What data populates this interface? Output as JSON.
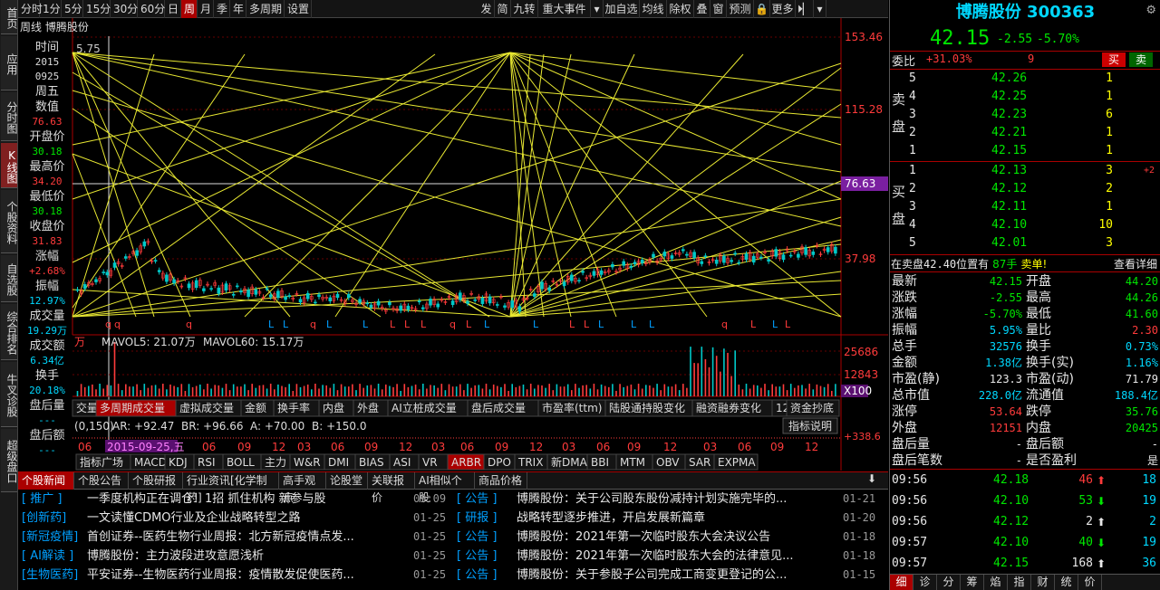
{
  "left_nav": [
    {
      "label": "首页",
      "active": false
    },
    {
      "label": "应用",
      "active": false
    },
    {
      "label": "分时图",
      "active": false
    },
    {
      "label": "K线图",
      "active": true
    },
    {
      "label": "个股资料",
      "active": false
    },
    {
      "label": "自选股",
      "active": false
    },
    {
      "label": "综合排名",
      "active": false
    },
    {
      "label": "牛叉诊股",
      "active": false
    },
    {
      "label": "超级盘口",
      "active": false
    }
  ],
  "toolbar": {
    "periods": [
      "分时",
      "1分",
      "5分",
      "15分",
      "30分",
      "60分",
      "日",
      "周",
      "月",
      "季",
      "年",
      "多周期",
      "设置"
    ],
    "active_period": "周",
    "right_items": [
      "发",
      "简",
      "九转",
      "重大事件",
      "▾",
      "加自选",
      "均线",
      "除权",
      "叠",
      "窗",
      "预测",
      "🔒",
      "更多",
      "⏵▏",
      "▾"
    ]
  },
  "chart": {
    "caption": "周线  博腾股份",
    "info_column": [
      {
        "label": "时间",
        "value": "2015",
        "color": "#ddd"
      },
      {
        "label": "",
        "value": "0925",
        "color": "#ddd"
      },
      {
        "label": "周五",
        "value": "",
        "color": "#ddd"
      },
      {
        "label": "数值",
        "value": "76.63",
        "color": "#ff3b3b"
      },
      {
        "label": "开盘价",
        "value": "30.18",
        "color": "#00e600"
      },
      {
        "label": "最高价",
        "value": "34.20",
        "color": "#ff3b3b"
      },
      {
        "label": "最低价",
        "value": "30.18",
        "color": "#00e600"
      },
      {
        "label": "收盘价",
        "value": "31.83",
        "color": "#ff3b3b"
      },
      {
        "label": "涨幅",
        "value": "+2.68%",
        "color": "#ff3b3b"
      },
      {
        "label": "振幅",
        "value": "12.97%",
        "color": "#00d8ff"
      },
      {
        "label": "成交量",
        "value": "19.29万",
        "color": "#00d8ff"
      },
      {
        "label": "成交额",
        "value": "6.34亿",
        "color": "#00d8ff"
      },
      {
        "label": "换手",
        "value": "20.18%",
        "color": "#00d8ff"
      },
      {
        "label": "盘后量",
        "value": "---",
        "color": "#00d8ff"
      },
      {
        "label": "盘后额",
        "value": "---",
        "color": "#00d8ff"
      }
    ],
    "price_axis": [
      "153.46",
      "115.28",
      "76.63",
      "37.98"
    ],
    "top_left_label": "5.75",
    "vol_axis": [
      "25686",
      "12843",
      "X100"
    ],
    "vol_legend": {
      "prefix": "万",
      "mavol5": "MAVOL5: 21.07万",
      "mavol60": "MAVOL60: 15.17万"
    },
    "vol_tabs": [
      "交量",
      "多周期成交量",
      "虚拟成交量",
      "金额",
      "换手率",
      "内盘",
      "外盘",
      "AI立桩成交量",
      "盘后成交量",
      "市盈率(ttm)",
      "陆股通持股变化",
      "融资融券变化",
      "12",
      "资金抄底"
    ],
    "active_vol_tab": "多周期成交量",
    "arbr_legend": {
      "params": "(0,150)",
      "ar": "AR: +92.47",
      "br": "BR: +96.66",
      "a": "A: +70.00",
      "b": "B: +150.0"
    },
    "indicator_button": "指标说明",
    "arbr_right": "+338.6",
    "date_axis": [
      "06",
      "2015-09-25,五",
      "06",
      "09",
      "12",
      "03",
      "06",
      "09",
      "12",
      "03",
      "06",
      "09",
      "12",
      "03",
      "06",
      "09",
      "12",
      "03",
      "06",
      "09",
      "12"
    ],
    "indicator_tabs": [
      "指标广场",
      "MACD",
      "KDJ",
      "RSI",
      "BOLL",
      "主力",
      "W&R",
      "DMI",
      "BIAS",
      "ASI",
      "VR",
      "ARBR",
      "DPO",
      "TRIX",
      "新DMA",
      "BBI",
      "MTM",
      "OBV",
      "SAR",
      "EXPMA"
    ],
    "active_indicator": "ARBR"
  },
  "news": {
    "tabs": [
      "个股新闻",
      "个股公告",
      "个股研报",
      "行业资讯[化学制药]",
      "高手观点",
      "论股堂",
      "关联报价",
      "AI相似个股",
      "商品价格"
    ],
    "active_tab": "个股新闻",
    "left": [
      {
        "tag": "[ 推广 ]",
        "title": "一季度机构正在调仓！1招 抓住机构 新参与股",
        "date": "09:09"
      },
      {
        "tag": "[创新药]",
        "title": "一文读懂CDMO行业及企业战略转型之路",
        "date": "01-25"
      },
      {
        "tag": "[新冠疫情]",
        "title": "首创证券--医药生物行业周报：北方新冠疫情点发...",
        "date": "01-25"
      },
      {
        "tag": "[ AI解读 ]",
        "title": "博腾股份：主力波段进攻意愿浅析",
        "date": "01-25"
      },
      {
        "tag": "[生物医药]",
        "title": "平安证券--生物医药行业周报：疫情散发促使医药...",
        "date": "01-25"
      }
    ],
    "right": [
      {
        "tag": "[ 公告 ]",
        "title": "博腾股份：关于公司股东股份减持计划实施完毕的...",
        "date": "01-21"
      },
      {
        "tag": "[ 研报 ]",
        "title": "战略转型逐步推进，开启发展新篇章",
        "date": "01-20"
      },
      {
        "tag": "[ 公告 ]",
        "title": "博腾股份：2021年第一次临时股东大会决议公告",
        "date": "01-18"
      },
      {
        "tag": "[ 公告 ]",
        "title": "博腾股份：2021年第一次临时股东大会的法律意见...",
        "date": "01-18"
      },
      {
        "tag": "[ 公告 ]",
        "title": "博腾股份：关于参股子公司完成工商变更登记的公...",
        "date": "01-15"
      }
    ]
  },
  "quote": {
    "name": "博腾股份 300363",
    "price": "42.15",
    "change": "-2.55",
    "change_pct": "-5.70%",
    "weibi_label": "委比",
    "weibi": "+31.03%",
    "weicha": "9",
    "buy_btn": "买",
    "sell_btn": "卖",
    "sell_side_label": "卖盘",
    "buy_side_label": "买盘",
    "asks": [
      {
        "level": "5",
        "price": "42.26",
        "vol": "1",
        "extra": ""
      },
      {
        "level": "4",
        "price": "42.25",
        "vol": "1",
        "extra": ""
      },
      {
        "level": "3",
        "price": "42.23",
        "vol": "6",
        "extra": ""
      },
      {
        "level": "2",
        "price": "42.21",
        "vol": "1",
        "extra": ""
      },
      {
        "level": "1",
        "price": "42.15",
        "vol": "1",
        "extra": ""
      }
    ],
    "bids": [
      {
        "level": "1",
        "price": "42.13",
        "vol": "3",
        "extra": "+2"
      },
      {
        "level": "2",
        "price": "42.12",
        "vol": "2",
        "extra": ""
      },
      {
        "level": "3",
        "price": "42.11",
        "vol": "1",
        "extra": ""
      },
      {
        "level": "4",
        "price": "42.10",
        "vol": "10",
        "extra": ""
      },
      {
        "level": "5",
        "price": "42.01",
        "vol": "3",
        "extra": ""
      }
    ],
    "notice": {
      "prefix": "在卖盘",
      "price": "42.40",
      "mid": "位置有",
      "qty": "87手",
      "suffix": "卖单!",
      "link": "查看详细"
    },
    "stats": [
      {
        "l": "最新",
        "v": "42.15",
        "vc": "green",
        "l2": "开盘",
        "v2": "44.20",
        "v2c": "green"
      },
      {
        "l": "涨跌",
        "v": "-2.55",
        "vc": "green",
        "l2": "最高",
        "v2": "44.26",
        "v2c": "green"
      },
      {
        "l": "涨幅",
        "v": "-5.70%",
        "vc": "green",
        "l2": "最低",
        "v2": "41.60",
        "v2c": "green"
      },
      {
        "l": "振幅",
        "v": "5.95%",
        "vc": "cyan",
        "l2": "量比",
        "v2": "2.30",
        "v2c": "red"
      },
      {
        "l": "总手",
        "v": "32576",
        "vc": "cyan",
        "l2": "换手",
        "v2": "0.73%",
        "v2c": "cyan"
      },
      {
        "l": "金额",
        "v": "1.38亿",
        "vc": "cyan",
        "l2": "换手(实)",
        "v2": "1.16%",
        "v2c": "cyan"
      },
      {
        "l": "市盈(静)",
        "v": "123.3",
        "vc": "white",
        "l2": "市盈(动)",
        "v2": "71.79",
        "v2c": "white"
      },
      {
        "l": "总市值",
        "v": "228.0亿",
        "vc": "cyan",
        "l2": "流通值",
        "v2": "188.4亿",
        "v2c": "cyan"
      },
      {
        "l": "涨停",
        "v": "53.64",
        "vc": "red",
        "l2": "跌停",
        "v2": "35.76",
        "v2c": "green"
      },
      {
        "l": "外盘",
        "v": "12151",
        "vc": "red",
        "l2": "内盘",
        "v2": "20425",
        "v2c": "green"
      },
      {
        "l": "盘后量",
        "v": "-",
        "vc": "white",
        "l2": "盘后额",
        "v2": "-",
        "v2c": "white"
      },
      {
        "l": "盘后笔数",
        "v": "-",
        "vc": "white",
        "l2": "是否盈利",
        "v2": "是",
        "v2c": "white"
      }
    ],
    "ticks": [
      {
        "time": "09:56",
        "price": "42.18",
        "vol": "46",
        "dir": "up",
        "n": "18"
      },
      {
        "time": "09:56",
        "price": "42.10",
        "vol": "53",
        "dir": "down",
        "n": "19"
      },
      {
        "time": "09:56",
        "price": "42.12",
        "vol": "2",
        "dir": "upw",
        "n": "2"
      },
      {
        "time": "09:57",
        "price": "42.10",
        "vol": "40",
        "dir": "down",
        "n": "19"
      },
      {
        "time": "09:57",
        "price": "42.15",
        "vol": "168",
        "dir": "upw",
        "n": "36"
      }
    ],
    "bottom_tabs": [
      "细",
      "诊",
      "分",
      "筹",
      "焰",
      "指",
      "财",
      "统",
      "价"
    ],
    "active_bottom_tab": "细"
  }
}
